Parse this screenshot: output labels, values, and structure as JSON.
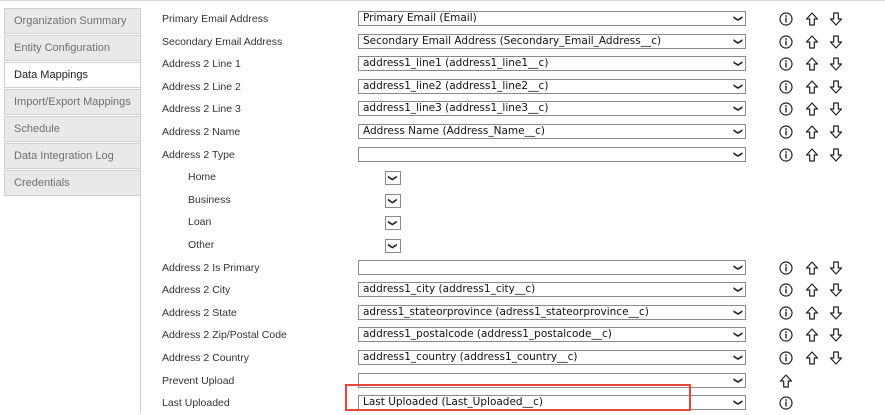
{
  "sidebar": {
    "tabs": [
      {
        "label": "Organization Summary",
        "active": false
      },
      {
        "label": "Entity Configuration",
        "active": false
      },
      {
        "label": "Data Mappings",
        "active": true
      },
      {
        "label": "Import/Export Mappings",
        "active": false
      },
      {
        "label": "Schedule",
        "active": false
      },
      {
        "label": "Data Integration Log",
        "active": false
      },
      {
        "label": "Credentials",
        "active": false
      }
    ]
  },
  "mappings": [
    {
      "label": "Primary Email Address",
      "value": "Primary Email (Email)"
    },
    {
      "label": "Secondary Email Address",
      "value": "Secondary Email Address (Secondary_Email_Address__c)"
    },
    {
      "label": "Address 2 Line 1",
      "value": "address1_line1 (address1_line1__c)"
    },
    {
      "label": "Address 2 Line 2",
      "value": "address1_line2 (address1_line2__c)"
    },
    {
      "label": "Address 2 Line 3",
      "value": "address1_line3 (address1_line3__c)"
    },
    {
      "label": "Address 2 Name",
      "value": "Address Name (Address_Name__c)"
    },
    {
      "label": "Address 2 Type",
      "value": ""
    },
    {
      "label": "Home",
      "value": ""
    },
    {
      "label": "Business",
      "value": ""
    },
    {
      "label": "Loan",
      "value": ""
    },
    {
      "label": "Other",
      "value": ""
    },
    {
      "label": "Address 2 Is Primary",
      "value": ""
    },
    {
      "label": "Address 2 City",
      "value": "address1_city (address1_city__c)"
    },
    {
      "label": "Address 2 State",
      "value": "adress1_stateorprovince (adress1_stateorprovince__c)"
    },
    {
      "label": "Address 2 Zip/Postal Code",
      "value": "address1_postalcode (address1_postalcode__c)"
    },
    {
      "label": "Address 2 Country",
      "value": "address1_country (address1_country__c)"
    },
    {
      "label": "Prevent Upload",
      "value": ""
    },
    {
      "label": "Last Uploaded",
      "value": "Last Uploaded (Last_Uploaded__c)"
    }
  ],
  "icons": {
    "info": "info-icon",
    "move_up": "arrow-up-icon",
    "move_down": "arrow-down-icon",
    "dropdown": "chevron-down-icon"
  },
  "colors": {
    "highlight_border": "#e5473a",
    "tab_inactive_bg": "#e9e9e9",
    "tab_inactive_text": "#6f6f6f"
  }
}
